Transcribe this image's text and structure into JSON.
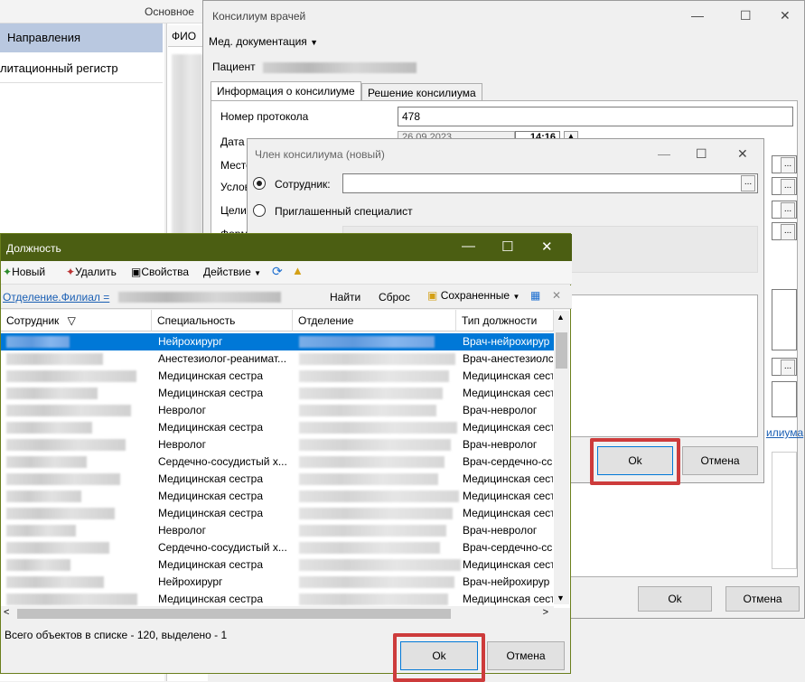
{
  "background": {
    "top_label": "Основное",
    "nav": [
      "Направления",
      "литационный регистр"
    ],
    "grid_header": "ФИО"
  },
  "konsilium": {
    "title": "Консилиум врачей",
    "menu_label": "Мед. документация",
    "patient_label": "Пациент",
    "tabs": [
      "Информация о консилиуме",
      "Решение консилиума"
    ],
    "fields": [
      {
        "label": "Номер протокола",
        "value": "478"
      },
      {
        "label": "Дата и время:",
        "value": "26.09.2023",
        "time": "14:16"
      },
      {
        "label": "Место"
      },
      {
        "label": "Услов"
      },
      {
        "label": "Цели"
      },
      {
        "label": "Форм"
      }
    ],
    "link_text": "илиума",
    "ok": "Ok",
    "cancel": "Отмена"
  },
  "member_dialog": {
    "title": "Член консилиума (новый)",
    "option_employee": "Сотрудник:",
    "option_invited": "Приглашенный специалист",
    "ok": "Ok",
    "cancel": "Отмена"
  },
  "position_dialog": {
    "title": "Должность",
    "toolbar": {
      "new": "Новый",
      "delete": "Удалить",
      "properties": "Свойства",
      "action": "Действие"
    },
    "filter": {
      "label": "Отделение.Филиал =",
      "find": "Найти",
      "reset": "Сброс",
      "saved": "Сохраненные"
    },
    "columns": [
      "Сотрудник",
      "Специальность",
      "Отделение",
      "Тип должности"
    ],
    "rows": [
      {
        "specialty": "Нейрохирург",
        "type": "Врач-нейрохирур",
        "selected": true
      },
      {
        "specialty": "Анестезиолог-реаниматолог",
        "specialty_display": "Анестезиолог-реанимат...",
        "type": "Врач-анестезиолс"
      },
      {
        "specialty": "Медицинская сестра",
        "type": "Медицинская сест"
      },
      {
        "specialty": "Медицинская сестра",
        "type": "Медицинская сест"
      },
      {
        "specialty": "Невролог",
        "type": "Врач-невролог"
      },
      {
        "specialty": "Медицинская сестра",
        "type": "Медицинская сест"
      },
      {
        "specialty": "Невролог",
        "type": "Врач-невролог"
      },
      {
        "specialty_display": "Сердечно-сосудистый х...",
        "type": "Врач-сердечно-сс"
      },
      {
        "specialty": "Медицинская сестра",
        "type": "Медицинская сест"
      },
      {
        "specialty": "Медицинская сестра",
        "type": "Медицинская сест"
      },
      {
        "specialty": "Медицинская сестра",
        "type": "Медицинская сест"
      },
      {
        "specialty": "Невролог",
        "type": "Врач-невролог"
      },
      {
        "specialty_display": "Сердечно-сосудистый х...",
        "type": "Врач-сердечно-сс"
      },
      {
        "specialty": "Медицинская сестра",
        "type": "Медицинская сест"
      },
      {
        "specialty": "Нейрохирург",
        "type": "Врач-нейрохирур"
      },
      {
        "specialty": "Медицинская сестра",
        "type": "Медицинская сест"
      }
    ],
    "status": "Всего объектов в списке - 120, выделено - 1",
    "ok": "Ok",
    "cancel": "Отмена"
  },
  "colors": {
    "position_titlebar": "#4b5e12",
    "selection": "#0078d7",
    "highlight": "#cd3b3b"
  }
}
